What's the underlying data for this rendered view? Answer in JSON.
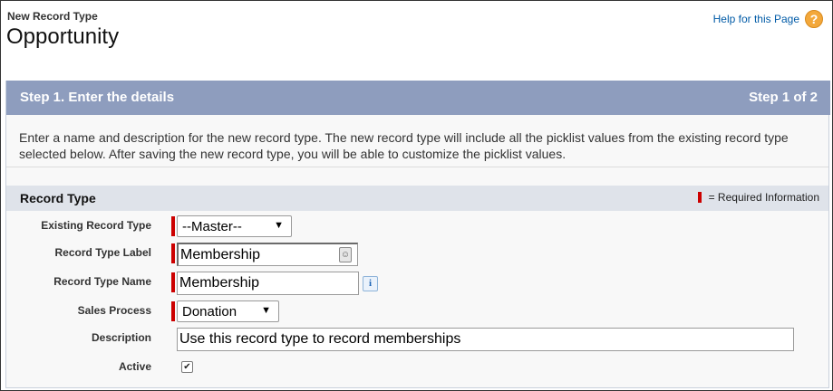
{
  "header": {
    "subtitle": "New Record Type",
    "title": "Opportunity",
    "help_label": "Help for this Page",
    "help_icon": "help-question-icon"
  },
  "step": {
    "title": "Step 1. Enter the details",
    "count": "Step 1 of 2"
  },
  "intro_text": "Enter a name and description for the new record type. The new record type will include all the picklist values from the existing record type selected below. After saving the new record type, you will be able to customize the picklist values.",
  "section": {
    "title": "Record Type",
    "required_legend": "= Required Information"
  },
  "form": {
    "existing_record_type": {
      "label": "Existing Record Type",
      "value": "--Master--",
      "required": true
    },
    "record_type_label": {
      "label": "Record Type Label",
      "value": "Membership",
      "required": true
    },
    "record_type_name": {
      "label": "Record Type Name",
      "value": "Membership",
      "required": true
    },
    "sales_process": {
      "label": "Sales Process",
      "value": "Donation",
      "required": true
    },
    "description": {
      "label": "Description",
      "value": "Use this record type to record memberships",
      "required": false
    },
    "active": {
      "label": "Active",
      "checked": true
    }
  },
  "colors": {
    "step_bar": "#8e9dbe",
    "section_bar": "#dfe3ea",
    "required": "#cc0000",
    "link": "#015ba7",
    "help_icon": "#f3a83b"
  }
}
